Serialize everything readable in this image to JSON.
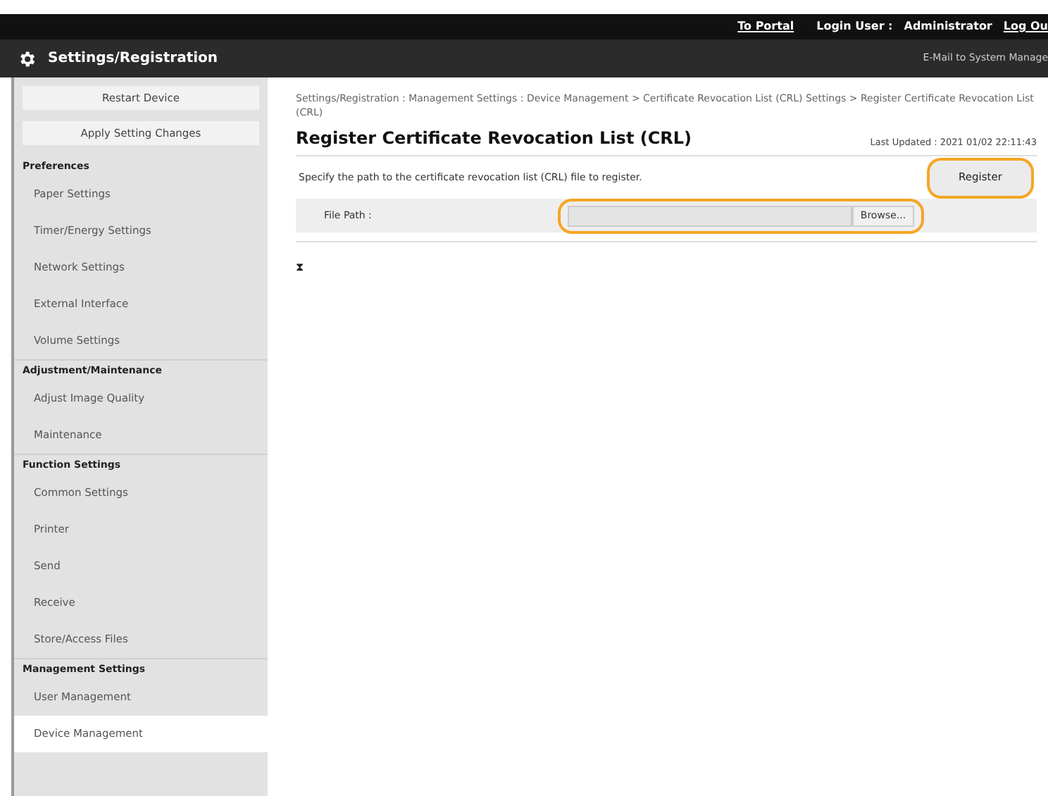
{
  "header": {
    "links": [
      "To Portal"
    ],
    "login_label": "Login User :",
    "user": "Administrator",
    "logout": "Log Ou",
    "title": "Settings/Registration",
    "mail_link": "E-Mail to System Manage"
  },
  "sidebar": {
    "buttons": [
      "Restart Device",
      "Apply Setting Changes"
    ],
    "sections": [
      {
        "heading": "Preferences",
        "items": [
          {
            "label": "Paper Settings",
            "selected": false
          },
          {
            "label": "Timer/Energy Settings",
            "selected": false
          },
          {
            "label": "Network Settings",
            "selected": false
          },
          {
            "label": "External Interface",
            "selected": false
          },
          {
            "label": "Volume Settings",
            "selected": false
          }
        ]
      },
      {
        "heading": "Adjustment/Maintenance",
        "items": [
          {
            "label": "Adjust Image Quality",
            "selected": false
          },
          {
            "label": "Maintenance",
            "selected": false
          }
        ]
      },
      {
        "heading": "Function Settings",
        "items": [
          {
            "label": "Common Settings",
            "selected": false
          },
          {
            "label": "Printer",
            "selected": false
          },
          {
            "label": "Send",
            "selected": false
          },
          {
            "label": "Receive",
            "selected": false
          },
          {
            "label": "Store/Access Files",
            "selected": false
          }
        ]
      },
      {
        "heading": "Management Settings",
        "items": [
          {
            "label": "User Management",
            "selected": false
          },
          {
            "label": "Device Management",
            "selected": true
          }
        ]
      }
    ]
  },
  "main": {
    "breadcrumb": "Settings/Registration : Management Settings : Device Management > Certificate Revocation List (CRL) Settings > Register Certificate Revocation List (CRL)",
    "title": "Register Certificate Revocation List (CRL)",
    "last_updated": "Last Updated : 2021 01/02 22:11:43",
    "description": "Specify the path to the certificate revocation list (CRL) file to register.",
    "register_button": "Register",
    "file_path_label": "File Path :",
    "browse_button": "Browse...",
    "top_link": "⧗"
  }
}
